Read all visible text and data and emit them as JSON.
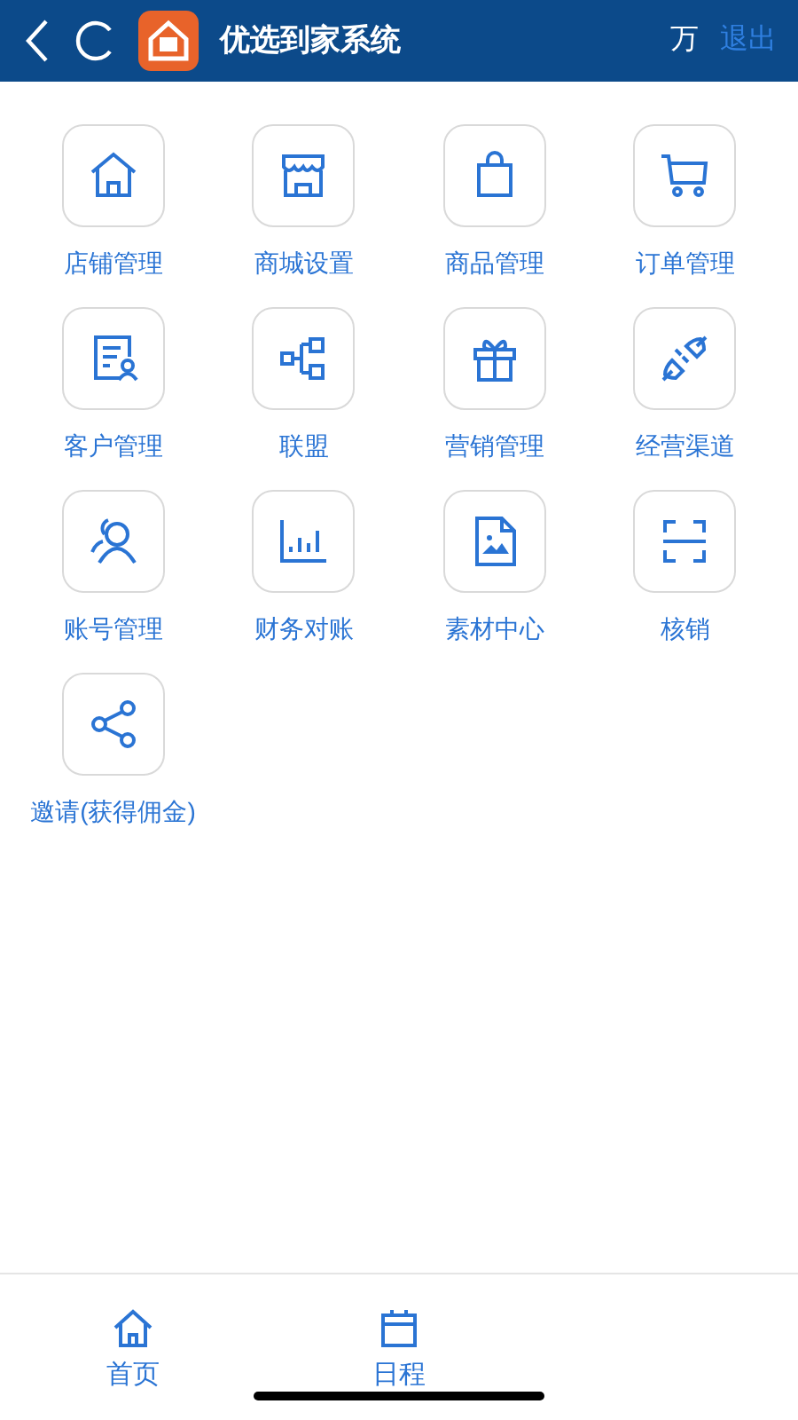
{
  "header": {
    "title": "优选到家系统",
    "user": "万",
    "logout": "退出"
  },
  "menu": [
    {
      "label": "店铺管理"
    },
    {
      "label": "商城设置"
    },
    {
      "label": "商品管理"
    },
    {
      "label": "订单管理"
    },
    {
      "label": "客户管理"
    },
    {
      "label": "联盟"
    },
    {
      "label": "营销管理"
    },
    {
      "label": "经营渠道"
    },
    {
      "label": "账号管理"
    },
    {
      "label": "财务对账"
    },
    {
      "label": "素材中心"
    },
    {
      "label": "核销"
    },
    {
      "label": "邀请(获得佣金)"
    }
  ],
  "tab_bar": [
    {
      "label": "首页"
    },
    {
      "label": "日程"
    }
  ]
}
